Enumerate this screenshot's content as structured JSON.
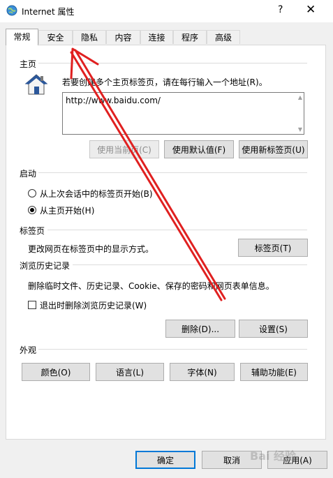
{
  "window": {
    "title": "Internet 属性",
    "help_glyph": "?",
    "close_glyph": "✕"
  },
  "tabs": [
    {
      "label": "常规",
      "active": true
    },
    {
      "label": "安全",
      "active": false
    },
    {
      "label": "隐私",
      "active": false
    },
    {
      "label": "内容",
      "active": false
    },
    {
      "label": "连接",
      "active": false
    },
    {
      "label": "程序",
      "active": false
    },
    {
      "label": "高级",
      "active": false
    }
  ],
  "home": {
    "section_label": "主页",
    "description": "若要创建多个主页标签页，请在每行输入一个地址(R)。",
    "url": "http://www.baidu.com/",
    "buttons": {
      "use_current": "使用当前页(C)",
      "use_default": "使用默认值(F)",
      "use_new_tab": "使用新标签页(U)"
    }
  },
  "startup": {
    "section_label": "启动",
    "option_last_session": "从上次会话中的标签页开始(B)",
    "option_home": "从主页开始(H)",
    "selected": "home"
  },
  "tabs_section": {
    "section_label": "标签页",
    "description": "更改网页在标签页中的显示方式。",
    "button": "标签页(T)"
  },
  "history": {
    "section_label": "浏览历史记录",
    "description": "删除临时文件、历史记录、Cookie、保存的密码和网页表单信息。",
    "checkbox_label": "退出时删除浏览历史记录(W)",
    "checkbox_checked": false,
    "delete_button": "删除(D)...",
    "settings_button": "设置(S)"
  },
  "appearance": {
    "section_label": "外观",
    "colors_button": "颜色(O)",
    "languages_button": "语言(L)",
    "fonts_button": "字体(N)",
    "accessibility_button": "辅助功能(E)"
  },
  "dialog_buttons": {
    "ok": "确定",
    "cancel": "取消",
    "apply": "应用(A)"
  },
  "watermark": "Bai 经验",
  "colors": {
    "annotation_arrow": "#e02020",
    "primary_border": "#0078d7",
    "house_roof": "#2b579a"
  }
}
